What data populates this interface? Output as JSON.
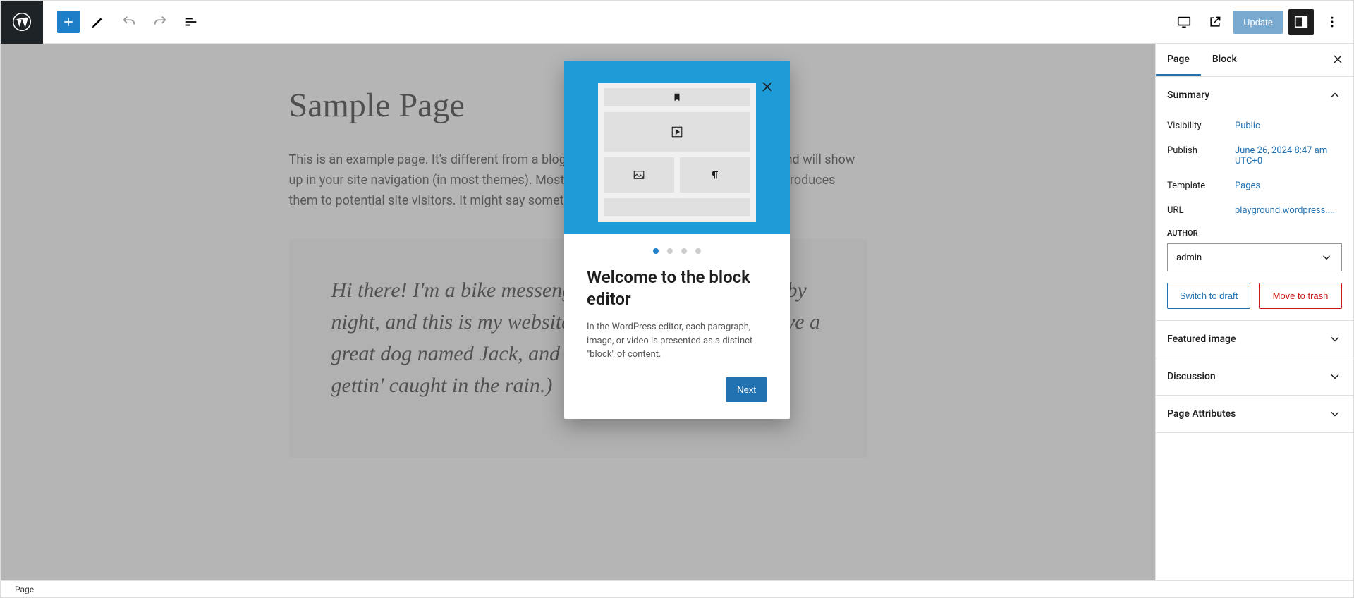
{
  "toolbar": {
    "update_label": "Update"
  },
  "content": {
    "title": "Sample Page",
    "body": "This is an example page. It's different from a blog post because it will stay in one place and will show up in your site navigation (in most themes). Most people start with an About page that introduces them to potential site visitors. It might say something like this:",
    "quote": "Hi there! I'm a bike messenger by day, aspiring actor by night, and this is my website. I live in Los Angeles, have a great dog named Jack, and I like piña coladas. (And gettin' caught in the rain.)"
  },
  "sidebar": {
    "tabs": {
      "page": "Page",
      "block": "Block"
    },
    "summary": {
      "heading": "Summary",
      "visibility_label": "Visibility",
      "visibility_value": "Public",
      "publish_label": "Publish",
      "publish_value": "June 26, 2024 8:47 am UTC+0",
      "template_label": "Template",
      "template_value": "Pages",
      "url_label": "URL",
      "url_value": "playground.wordpress....",
      "author_label": "AUTHOR",
      "author_value": "admin",
      "switch_draft": "Switch to draft",
      "move_trash": "Move to trash"
    },
    "panels": {
      "featured_image": "Featured image",
      "discussion": "Discussion",
      "page_attributes": "Page Attributes"
    }
  },
  "modal": {
    "title": "Welcome to the block editor",
    "text": "In the WordPress editor, each paragraph, image, or video is presented as a distinct \"block\" of content.",
    "next": "Next"
  },
  "footer": {
    "breadcrumb": "Page"
  }
}
